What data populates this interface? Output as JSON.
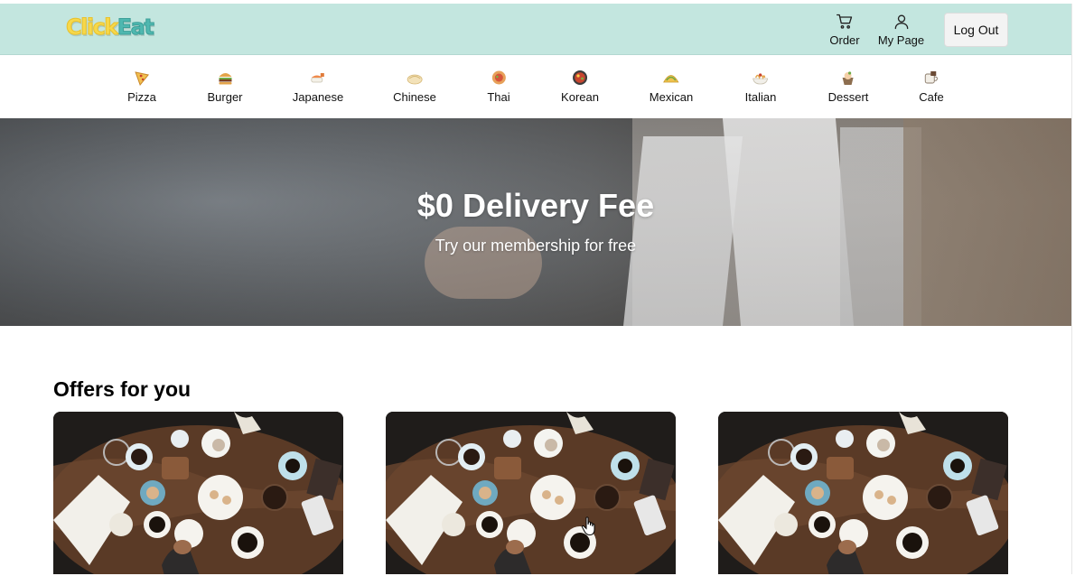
{
  "brand": {
    "logo_part1": "Click",
    "logo_part2": "Eat"
  },
  "header": {
    "order_label": "Order",
    "mypage_label": "My Page",
    "logout_label": "Log Out",
    "background_color": "#c3e6df"
  },
  "categories": [
    {
      "label": "Pizza",
      "icon": "pizza-icon"
    },
    {
      "label": "Burger",
      "icon": "burger-icon"
    },
    {
      "label": "Japanese",
      "icon": "sushi-icon"
    },
    {
      "label": "Chinese",
      "icon": "dumpling-icon"
    },
    {
      "label": "Thai",
      "icon": "thai-bowl-icon"
    },
    {
      "label": "Korean",
      "icon": "korean-bowl-icon"
    },
    {
      "label": "Mexican",
      "icon": "taco-icon"
    },
    {
      "label": "Italian",
      "icon": "pasta-icon"
    },
    {
      "label": "Dessert",
      "icon": "dessert-icon"
    },
    {
      "label": "Cafe",
      "icon": "coffee-icon"
    }
  ],
  "hero": {
    "title": "$0 Delivery Fee",
    "subtitle": "Try our membership for free"
  },
  "offers": {
    "title": "Offers for you",
    "cards": [
      {
        "image": "cafe-table-photo"
      },
      {
        "image": "cafe-table-photo"
      },
      {
        "image": "cafe-table-photo"
      }
    ]
  }
}
